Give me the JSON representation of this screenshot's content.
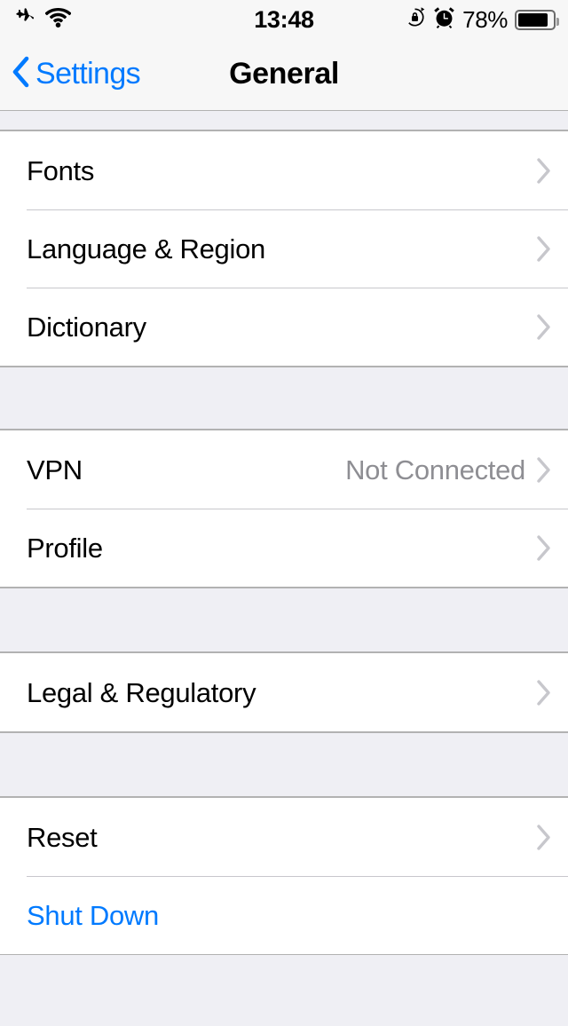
{
  "status_bar": {
    "airplane_icon": "airplane-icon",
    "wifi_icon": "wifi-icon",
    "time": "13:48",
    "rotation_lock_icon": "rotation-lock-icon",
    "alarm_icon": "alarm-clock-icon",
    "battery_percent": "78%",
    "battery_level": 78
  },
  "nav": {
    "back_label": "Settings",
    "back_icon": "chevron-left-icon",
    "title": "General"
  },
  "colors": {
    "tint": "#007AFF",
    "detail_gray": "#8E8E93",
    "chevron_gray": "#C7C7CC",
    "group_bg": "#EFEFF4",
    "row_bg": "#FFFFFF",
    "separator": "#C8C7CC"
  },
  "sections": [
    {
      "rows": [
        {
          "label": "Fonts",
          "detail": "",
          "chevron": true,
          "tinted": false
        },
        {
          "label": "Language & Region",
          "detail": "",
          "chevron": true,
          "tinted": false
        },
        {
          "label": "Dictionary",
          "detail": "",
          "chevron": true,
          "tinted": false
        }
      ]
    },
    {
      "rows": [
        {
          "label": "VPN",
          "detail": "Not Connected",
          "chevron": true,
          "tinted": false
        },
        {
          "label": "Profile",
          "detail": "",
          "chevron": true,
          "tinted": false
        }
      ]
    },
    {
      "rows": [
        {
          "label": "Legal & Regulatory",
          "detail": "",
          "chevron": true,
          "tinted": false
        }
      ]
    },
    {
      "rows": [
        {
          "label": "Reset",
          "detail": "",
          "chevron": true,
          "tinted": false
        },
        {
          "label": "Shut Down",
          "detail": "",
          "chevron": false,
          "tinted": true
        }
      ]
    }
  ]
}
